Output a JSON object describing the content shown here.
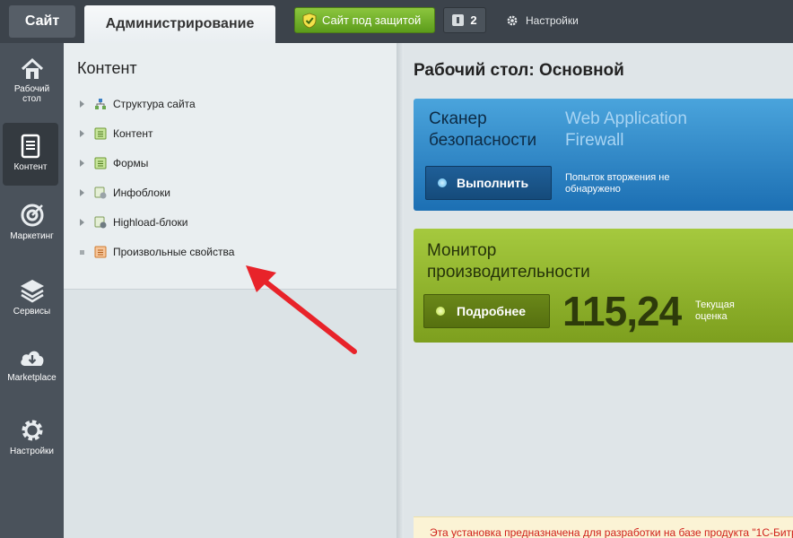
{
  "topbar": {
    "site_tab": "Сайт",
    "admin_tab": "Администрирование",
    "secure_button": "Сайт под защитой",
    "notifications_count": "2",
    "settings_label": "Настройки"
  },
  "leftmenu": {
    "items": [
      {
        "label": "Рабочий стол",
        "icon": "home-icon"
      },
      {
        "label": "Контент",
        "icon": "document-icon"
      },
      {
        "label": "Маркетинг",
        "icon": "target-icon"
      },
      {
        "label": "Сервисы",
        "icon": "layers-icon"
      },
      {
        "label": "Marketplace",
        "icon": "cloud-download-icon"
      },
      {
        "label": "Настройки",
        "icon": "gear-icon"
      }
    ]
  },
  "panel": {
    "title": "Контент",
    "items": [
      {
        "label": "Структура сайта"
      },
      {
        "label": "Контент"
      },
      {
        "label": "Формы"
      },
      {
        "label": "Инфоблоки"
      },
      {
        "label": "Highload-блоки"
      },
      {
        "label": "Произвольные свойства"
      }
    ]
  },
  "main": {
    "title": "Рабочий стол: Основной",
    "scanner": {
      "title_line1": "Сканер",
      "title_line2": "безопасности",
      "waf_line1": "Web Application",
      "waf_line2": "Firewall",
      "run_button": "Выполнить",
      "note": "Попыток вторжения не обнаружено"
    },
    "monitor": {
      "title_line1": "Монитор",
      "title_line2": "производительности",
      "more_button": "Подробнее",
      "score": "115,24",
      "score_label": "Текущая оценка"
    },
    "warning": "Эта установка предназначена для разработки на базе продукта \"1С-Битр"
  },
  "colors": {
    "accent_green": "#6fae28",
    "scanner_blue": "#2a86c9",
    "monitor_green": "#96bb32",
    "warning_red": "#d0211b",
    "arrow_red": "#e8232a"
  }
}
